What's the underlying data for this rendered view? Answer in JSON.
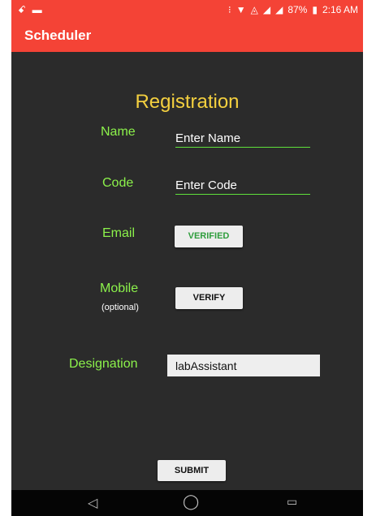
{
  "status": {
    "left_icons": [
      "app-notification-icon",
      "image-icon"
    ],
    "battery": "87%",
    "time": "2:16 AM"
  },
  "appbar": {
    "title": "Scheduler"
  },
  "form": {
    "heading": "Registration",
    "name": {
      "label": "Name",
      "value": "Enter Name"
    },
    "code": {
      "label": "Code",
      "value": "Enter Code"
    },
    "email": {
      "label": "Email",
      "button": "VERIFIED"
    },
    "mobile": {
      "label": "Mobile",
      "sublabel": "(optional)",
      "button": "VERIFY"
    },
    "designation": {
      "label": "Designation",
      "value": "labAssistant"
    },
    "submit": "SUBMIT"
  },
  "colors": {
    "accent": "#f44336",
    "label_green": "#8cf24b",
    "heading_yellow": "#f4d03f",
    "verified_text": "#2e9d3c"
  }
}
